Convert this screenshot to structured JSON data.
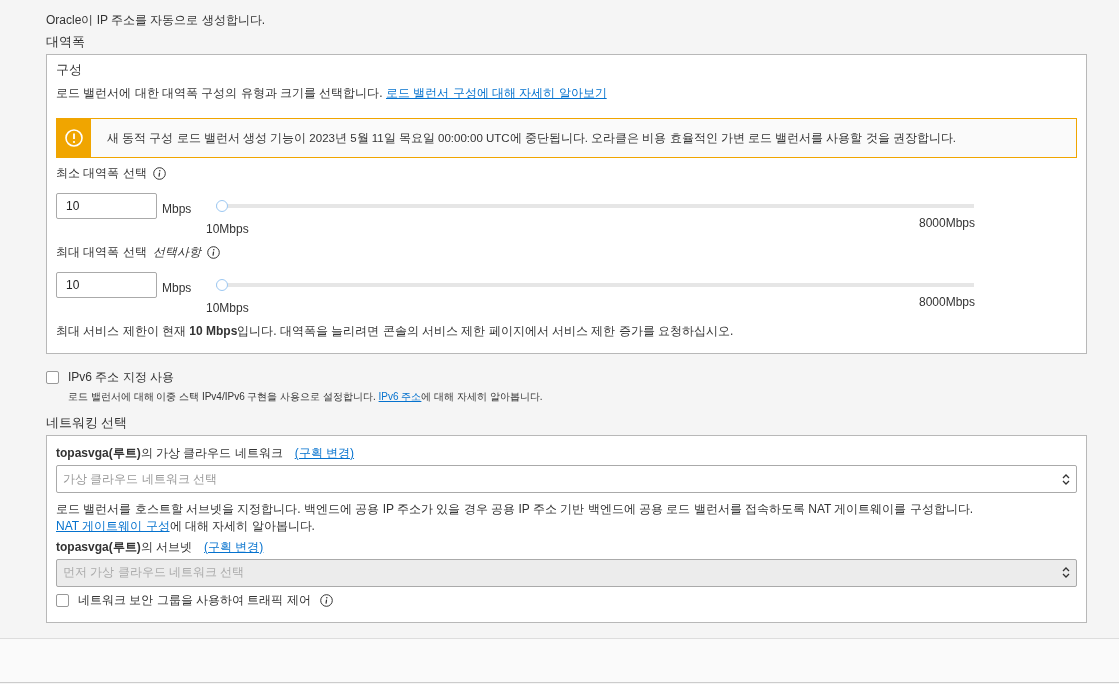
{
  "intro": "Oracle이 IP 주소를 자동으로 생성합니다.",
  "bandwidth": {
    "title": "대역폭",
    "heading": "구성",
    "description": "로드 밸런서에 대한 대역폭 구성의 유형과 크기를 선택합니다.",
    "link": "로드 밸런서 구성에 대해 자세히 알아보기",
    "warning": "새 동적 구성 로드 밸런서 생성 기능이 2023년 5월 11일 목요일 00:00:00 UTC에 중단됩니다. 오라클은 비용 효율적인 가변 로드 밸런서를 사용할 것을 권장합니다.",
    "sliders": [
      {
        "label": "최소 대역폭 선택",
        "value": "10",
        "unit": "Mbps",
        "level": 0,
        "min_label": "10Mbps",
        "max_label": "8000Mbps"
      },
      {
        "label": "최대 대역폭 선택",
        "optional": "선택사항",
        "value": "10",
        "unit": "Mbps",
        "level": 0,
        "min_label": "10Mbps",
        "max_label": "8000Mbps"
      }
    ],
    "note": "최대 서비스 제한이 현재 **10 Mbps**입니다. 대역폭을 늘리려면 콘솔의 서비스 제한 페이지에서 서비스 제한 증가를 요청하십시오."
  },
  "ipv6": {
    "label": "IPv6 주소 지정 사용",
    "checked": false,
    "description": "로드 밸런서에 대해 이중 스택 IPv4/IPv6 구현을 사용으로 설정합니다. ",
    "link": "IPv6 주소",
    "description_after": "에 대해 자세히 알아봅니다."
  },
  "networking": {
    "title": "네트워킹 선택",
    "vcn": {
      "label": "**topasvga(루트)**의 가상 클라우드 네트워크",
      "change_link": "(구획 변경)",
      "placeholder": "가상 클라우드 네트워크 선택",
      "disabled": false
    },
    "help": "로드 밸런서를 호스트할 서브넷을 지정합니다. 백엔드에 공용 IP 주소가 있을 경우 공용 IP 주소 기반 백엔드에 공용 로드 밸런서를 접속하도록 NAT 게이트웨이를 구성합니다. ",
    "help_link": "NAT 게이트웨이 구성",
    "help_after": "에 대해 자세히 알아봅니다.",
    "subnet": {
      "label": "**topasvga(루트)**의 서브넷",
      "change_link": "(구획 변경)",
      "placeholder": "먼저 가상 클라우드 네트워크 선택",
      "disabled": true
    },
    "nsg": {
      "label": "네트워크 보안 그룹을 사용하여 트래픽 제어",
      "checked": false
    }
  }
}
